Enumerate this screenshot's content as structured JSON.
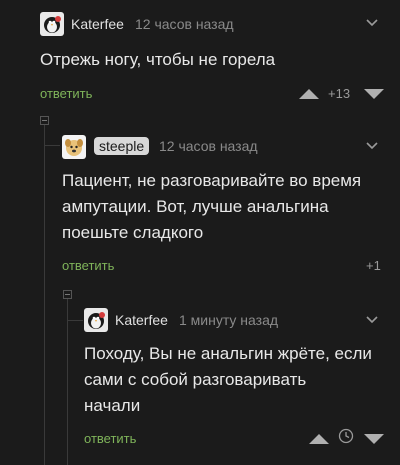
{
  "comments": [
    {
      "author": "Katerfee",
      "time": "12 часов назад",
      "text": "Отрежь ногу, чтобы не горела",
      "reply_label": "ответить",
      "rating": "+13"
    },
    {
      "author": "steeple",
      "time": "12 часов назад",
      "text_lines": [
        "Пациент, не разговаривайте во время",
        "ампутации. Вот, лучше анальгина",
        "поешьте сладкого"
      ],
      "reply_label": "ответить",
      "rating": "+1"
    },
    {
      "author": "Katerfee",
      "time": "1 минуту назад",
      "text_lines": [
        "Походу, Вы не анальгин жрёте, если",
        "сами с собой разговаривать",
        "начали"
      ],
      "reply_label": "ответить"
    }
  ],
  "colors": {
    "background": "#1b1b1b",
    "reply_link": "#7fb45a",
    "meta_text": "#8a8a8a"
  },
  "icons": {
    "avatar_katerfee": "penguin-avatar-icon",
    "avatar_steeple": "dog-avatar-icon",
    "collapse": "chevron-down-icon",
    "vote_up": "triangle-up-icon",
    "vote_down": "triangle-down-icon",
    "timer": "clock-icon"
  }
}
